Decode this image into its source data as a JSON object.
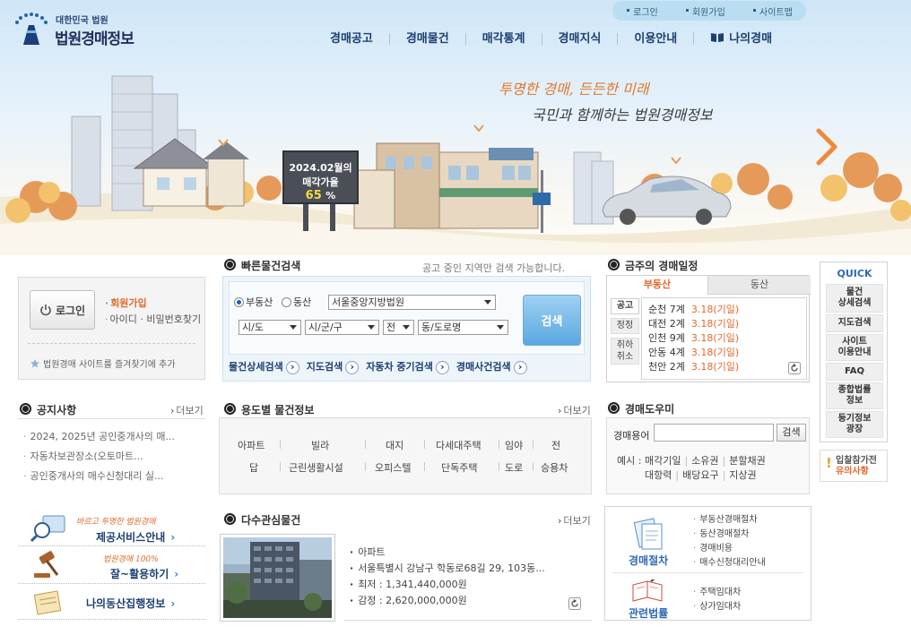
{
  "logo": {
    "sub": "대한민국 법원",
    "main": "법원경매정보"
  },
  "top_links": [
    "로그인",
    "회원가입",
    "사이트맵"
  ],
  "gnb": [
    "경매공고",
    "경매물건",
    "매각통계",
    "경매지식",
    "이용안내",
    "나의경매"
  ],
  "hero": {
    "slogan1": "투명한 경매, 든든한 미래",
    "slogan2": "국민과 함께하는 법원경매정보",
    "rate_line1": "2024.02월의",
    "rate_line2": "매각가율",
    "rate_value": "65",
    "rate_unit": "%"
  },
  "login": {
    "button": "로그인",
    "join": "회원가입",
    "find": "아이디 · 비밀번호찾기",
    "favorite": "법원경매 사이트를 즐겨찾기에 추가"
  },
  "quick_search": {
    "title": "빠른물건검색",
    "note": "공고 중인 지역만 검색 가능합니다.",
    "radio_real": "부동산",
    "radio_movable": "동산",
    "court": "서울중앙지방법원",
    "sido": "시/도",
    "sigungu": "시/군/구",
    "all": "전",
    "dong": "동/도로명",
    "search": "검색",
    "links": [
      "물건상세검색",
      "지도검색",
      "자동차 중기검색",
      "경매사건검색"
    ]
  },
  "weekly": {
    "title": "금주의 경매일정",
    "tab_real": "부동산",
    "tab_movable": "동산",
    "side": [
      "공고",
      "정정",
      "취하\n취소"
    ],
    "rows": [
      {
        "place": "순천",
        "count": "7계",
        "date": "3.18",
        "day": "(기일)"
      },
      {
        "place": "대전",
        "count": "2계",
        "date": "3.18",
        "day": "(기일)"
      },
      {
        "place": "인천",
        "count": "9계",
        "date": "3.18",
        "day": "(기일)"
      },
      {
        "place": "안동",
        "count": "4계",
        "date": "3.18",
        "day": "(기일)"
      },
      {
        "place": "천안",
        "count": "2계",
        "date": "3.18",
        "day": "(기일)"
      }
    ]
  },
  "quick_menu": {
    "title": "QUICK",
    "items": [
      "물건\n상세검색",
      "지도검색",
      "사이트\n이용안내",
      "FAQ",
      "종합법률\n정보",
      "등기정보\n광장"
    ],
    "caution1": "입찰참가전",
    "caution2": "유의사항"
  },
  "notices": {
    "title": "공지사항",
    "more": "더보기",
    "items": [
      "2024, 2025년 공인중개사의 매...",
      "자동차보관장소(오토마트...",
      "공인중개사의 매수신청대리 실..."
    ]
  },
  "usage": {
    "title": "용도별 물건정보",
    "more": "더보기",
    "row1": [
      "아파트",
      "빌라",
      "대지",
      "다세대주택",
      "임야",
      "전"
    ],
    "row2": [
      "답",
      "근린생활시설",
      "오피스텔",
      "단독주택",
      "도로",
      "승용차"
    ]
  },
  "help": {
    "title": "경매도우미",
    "label": "경매용어",
    "button": "검색",
    "prefix": "예시 :",
    "terms1": [
      "매각기일",
      "소유권",
      "분할채권"
    ],
    "terms2": [
      "대항력",
      "배당요구",
      "지상권"
    ]
  },
  "left_banners": [
    {
      "small": "바르고 투명한 법원경매",
      "large": "제공서비스안내"
    },
    {
      "small": "법원경매 100% ",
      "large": "잘~활용하기"
    },
    {
      "small": "",
      "large": "나의동산집행정보"
    }
  ],
  "multi": {
    "title": "다수관심물건",
    "more": "더보기",
    "items": [
      "아파트",
      "서울특별시 강남구 학동로68길 29, 103동...",
      "최저 : 1,341,440,000원",
      "감정 : 2,620,000,000원"
    ]
  },
  "procedures": {
    "label1": "경매절차",
    "list1": [
      "부동산경매절차",
      "동산경매절차",
      "경매비용",
      "매수신청대리안내"
    ],
    "label2": "관련법률",
    "list2": [
      "주택임대차",
      "상가임대차"
    ]
  },
  "colors": {
    "accent": "#e4682a",
    "navy": "#1c3f72",
    "link_blue": "#2e69b8"
  }
}
